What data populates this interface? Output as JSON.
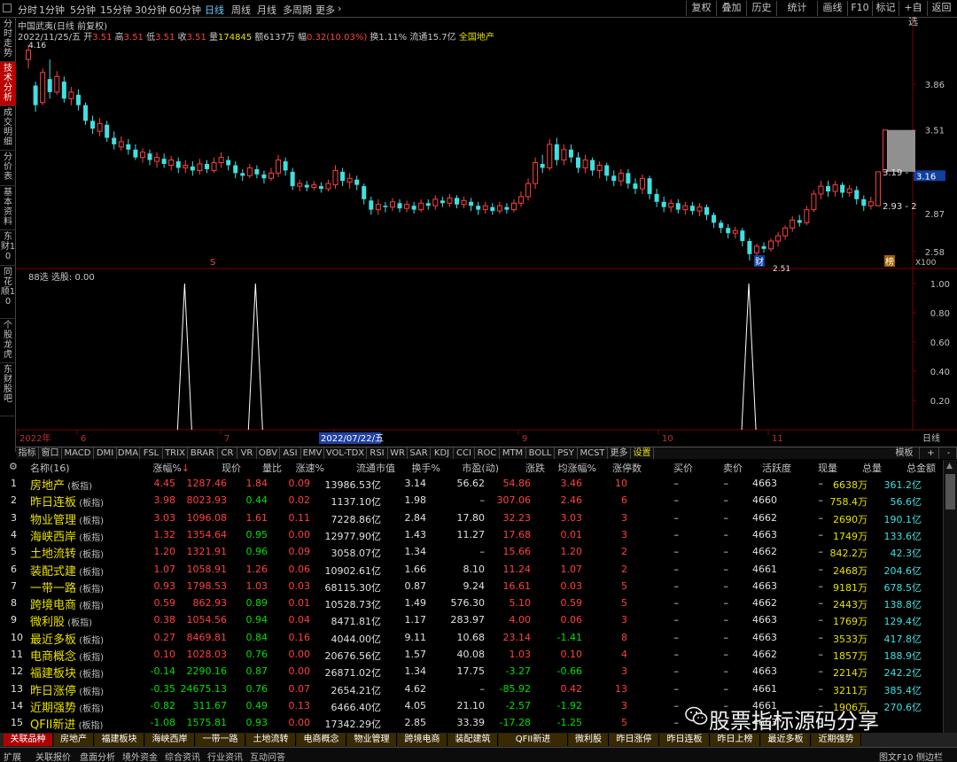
{
  "topbar": {
    "periods": [
      "分时",
      "1分钟",
      "5分钟",
      "15分钟",
      "30分钟",
      "60分钟",
      "日线",
      "周线",
      "月线",
      "多周期",
      "更多"
    ],
    "active_period": "日线",
    "right_buttons": [
      "复权",
      "叠加",
      "历史",
      "统计",
      "画线",
      "F10",
      "标记",
      "+自选",
      "返回"
    ]
  },
  "left_tabs": [
    "分时走势",
    "技术分析",
    "成交明细",
    "分价表",
    "基本资料",
    "东财10",
    "同花顺10",
    "个股龙虎",
    "东财股吧"
  ],
  "chart": {
    "title": "中国武夷(日线 前复权)",
    "date": "2022/11/25/五",
    "open_label": "开",
    "open": "3.51",
    "high_label": "高",
    "high": "3.51",
    "low_label": "低",
    "low": "3.51",
    "close_label": "收",
    "close": "3.51",
    "vol_label": "量",
    "vol": "174845",
    "amt_label": "额",
    "amt": "6137万",
    "chg_label": "幅",
    "chg": "0.32(10.03%)",
    "turnover": "换1.11%",
    "float": "流通15.7亿",
    "sector": "全国地产",
    "price_axis": [
      "3.86",
      "3.51",
      "3.16",
      "2.87",
      "2.58"
    ],
    "current_price_tag": "3.16",
    "label_high": "4.16",
    "label_low": "2.51",
    "label_b": "3.19 -",
    "label_c": "2.93 - 2",
    "marker_s": "S",
    "marker_cai": "财",
    "marker_x": "X100",
    "marker_bang": "榜",
    "sub_title": "88选",
    "sub_value_label": "选股: 0.00",
    "sub_axis": [
      "1.00",
      "0.80",
      "0.60",
      "0.40",
      "0.20"
    ],
    "x_labels": [
      "2022年",
      "6",
      "7",
      "8",
      "9",
      "10",
      "11"
    ],
    "x_highlight": "2022/07/22/五",
    "period_tag": "日线",
    "candles": [
      [
        4.05,
        4.12,
        3.98,
        4.16
      ],
      [
        3.85,
        3.7,
        3.65,
        3.88
      ],
      [
        3.72,
        3.95,
        3.7,
        3.98
      ],
      [
        3.9,
        3.8,
        3.75,
        4.05
      ],
      [
        3.8,
        3.92,
        3.78,
        3.96
      ],
      [
        3.88,
        3.75,
        3.72,
        3.92
      ],
      [
        3.75,
        3.8,
        3.7,
        3.84
      ],
      [
        3.78,
        3.7,
        3.66,
        3.82
      ],
      [
        3.7,
        3.58,
        3.55,
        3.72
      ],
      [
        3.58,
        3.52,
        3.48,
        3.62
      ],
      [
        3.5,
        3.56,
        3.46,
        3.6
      ],
      [
        3.55,
        3.45,
        3.42,
        3.58
      ],
      [
        3.45,
        3.4,
        3.36,
        3.5
      ],
      [
        3.38,
        3.42,
        3.35,
        3.46
      ],
      [
        3.4,
        3.36,
        3.32,
        3.44
      ],
      [
        3.36,
        3.3,
        3.28,
        3.4
      ],
      [
        3.3,
        3.34,
        3.26,
        3.37
      ],
      [
        3.33,
        3.28,
        3.24,
        3.36
      ],
      [
        3.27,
        3.3,
        3.22,
        3.34
      ],
      [
        3.29,
        3.25,
        3.22,
        3.33
      ],
      [
        3.24,
        3.28,
        3.2,
        3.31
      ],
      [
        3.27,
        3.22,
        3.18,
        3.3
      ],
      [
        3.22,
        3.24,
        3.18,
        3.28
      ],
      [
        3.23,
        3.2,
        3.16,
        3.27
      ],
      [
        3.2,
        3.25,
        3.17,
        3.29
      ],
      [
        3.25,
        3.21,
        3.18,
        3.28
      ],
      [
        3.2,
        3.26,
        3.18,
        3.3
      ],
      [
        3.26,
        3.3,
        3.22,
        3.34
      ],
      [
        3.28,
        3.24,
        3.2,
        3.31
      ],
      [
        3.24,
        3.18,
        3.14,
        3.27
      ],
      [
        3.18,
        3.16,
        3.12,
        3.21
      ],
      [
        3.16,
        3.22,
        3.14,
        3.25
      ],
      [
        3.21,
        3.17,
        3.14,
        3.24
      ],
      [
        3.17,
        3.14,
        3.1,
        3.2
      ],
      [
        3.14,
        3.18,
        3.12,
        3.22
      ],
      [
        3.18,
        3.28,
        3.15,
        3.32
      ],
      [
        3.27,
        3.2,
        3.16,
        3.3
      ],
      [
        3.19,
        3.08,
        3.05,
        3.22
      ],
      [
        3.08,
        3.1,
        3.04,
        3.13
      ],
      [
        3.09,
        3.07,
        3.04,
        3.12
      ],
      [
        3.07,
        3.09,
        3.05,
        3.12
      ],
      [
        3.08,
        3.06,
        3.03,
        3.11
      ],
      [
        3.06,
        3.1,
        3.04,
        3.13
      ],
      [
        3.09,
        3.2,
        3.06,
        3.24
      ],
      [
        3.19,
        3.12,
        3.08,
        3.22
      ],
      [
        3.11,
        3.14,
        3.06,
        3.18
      ],
      [
        3.13,
        3.09,
        3.05,
        3.16
      ],
      [
        3.08,
        2.98,
        2.94,
        3.1
      ],
      [
        2.97,
        2.9,
        2.86,
        3.0
      ],
      [
        2.9,
        2.94,
        2.86,
        2.98
      ],
      [
        2.93,
        2.92,
        2.88,
        2.96
      ],
      [
        2.92,
        2.96,
        2.89,
        2.99
      ],
      [
        2.95,
        2.91,
        2.88,
        2.98
      ],
      [
        2.91,
        2.94,
        2.88,
        2.97
      ],
      [
        2.93,
        2.9,
        2.87,
        2.96
      ],
      [
        2.9,
        2.95,
        2.88,
        2.98
      ],
      [
        2.95,
        2.93,
        2.9,
        2.98
      ],
      [
        2.93,
        2.98,
        2.9,
        3.01
      ],
      [
        2.97,
        2.95,
        2.92,
        3.0
      ],
      [
        2.95,
        2.99,
        2.92,
        3.02
      ],
      [
        2.99,
        2.94,
        2.91,
        3.01
      ],
      [
        2.94,
        2.97,
        2.91,
        3.0
      ],
      [
        2.96,
        2.93,
        2.89,
        2.99
      ],
      [
        2.93,
        2.9,
        2.86,
        2.96
      ],
      [
        2.9,
        2.93,
        2.87,
        2.96
      ],
      [
        2.92,
        2.89,
        2.86,
        2.95
      ],
      [
        2.89,
        2.93,
        2.87,
        2.96
      ],
      [
        2.92,
        2.9,
        2.87,
        2.95
      ],
      [
        2.9,
        2.95,
        2.88,
        2.98
      ],
      [
        2.95,
        3.0,
        2.92,
        3.04
      ],
      [
        3.0,
        3.1,
        2.97,
        3.14
      ],
      [
        3.1,
        3.26,
        3.06,
        3.3
      ],
      [
        3.25,
        3.22,
        3.18,
        3.32
      ],
      [
        3.22,
        3.4,
        3.2,
        3.44
      ],
      [
        3.4,
        3.28,
        3.24,
        3.45
      ],
      [
        3.28,
        3.36,
        3.24,
        3.4
      ],
      [
        3.36,
        3.3,
        3.26,
        3.4
      ],
      [
        3.3,
        3.22,
        3.18,
        3.34
      ],
      [
        3.22,
        3.28,
        3.18,
        3.32
      ],
      [
        3.28,
        3.2,
        3.16,
        3.3
      ],
      [
        3.2,
        3.24,
        3.14,
        3.27
      ],
      [
        3.24,
        3.16,
        3.12,
        3.26
      ],
      [
        3.16,
        3.12,
        3.08,
        3.2
      ],
      [
        3.12,
        3.18,
        3.08,
        3.21
      ],
      [
        3.18,
        3.1,
        3.06,
        3.21
      ],
      [
        3.1,
        3.06,
        3.02,
        3.14
      ],
      [
        3.06,
        3.14,
        3.02,
        3.17
      ],
      [
        3.14,
        3.02,
        2.98,
        3.16
      ],
      [
        3.02,
        2.96,
        2.92,
        3.06
      ],
      [
        2.96,
        2.92,
        2.88,
        3.0
      ],
      [
        2.92,
        2.95,
        2.88,
        2.98
      ],
      [
        2.95,
        2.9,
        2.87,
        2.98
      ],
      [
        2.9,
        2.93,
        2.86,
        2.96
      ],
      [
        2.93,
        2.89,
        2.86,
        2.96
      ],
      [
        2.89,
        2.92,
        2.85,
        2.95
      ],
      [
        2.92,
        2.86,
        2.82,
        2.94
      ],
      [
        2.86,
        2.8,
        2.76,
        2.88
      ],
      [
        2.8,
        2.76,
        2.72,
        2.82
      ],
      [
        2.76,
        2.72,
        2.68,
        2.79
      ],
      [
        2.72,
        2.74,
        2.68,
        2.77
      ],
      [
        2.74,
        2.66,
        2.62,
        2.76
      ],
      [
        2.66,
        2.56,
        2.51,
        2.68
      ],
      [
        2.57,
        2.62,
        2.55,
        2.64
      ],
      [
        2.62,
        2.6,
        2.57,
        2.65
      ],
      [
        2.6,
        2.66,
        2.58,
        2.68
      ],
      [
        2.66,
        2.7,
        2.62,
        2.73
      ],
      [
        2.7,
        2.76,
        2.67,
        2.78
      ],
      [
        2.76,
        2.82,
        2.73,
        2.85
      ],
      [
        2.82,
        2.8,
        2.77,
        2.86
      ],
      [
        2.8,
        2.9,
        2.78,
        2.93
      ],
      [
        2.9,
        3.02,
        2.88,
        3.05
      ],
      [
        3.02,
        3.08,
        2.98,
        3.12
      ],
      [
        3.08,
        3.04,
        3.0,
        3.12
      ],
      [
        3.04,
        3.09,
        3.0,
        3.12
      ],
      [
        3.09,
        3.03,
        2.99,
        3.11
      ],
      [
        3.03,
        3.06,
        3.0,
        3.09
      ],
      [
        3.05,
        2.98,
        2.94,
        3.08
      ],
      [
        2.98,
        2.93,
        2.89,
        3.01
      ],
      [
        2.93,
        2.96,
        2.9,
        3.0
      ],
      [
        2.93,
        3.19,
        2.93,
        3.19
      ],
      [
        3.19,
        3.51,
        3.19,
        3.51
      ]
    ],
    "signal_positions": [
      0.185,
      0.267,
      0.838
    ]
  },
  "indicators": [
    "指标",
    "窗口",
    "MACD",
    "DMI",
    "DMA",
    "FSL",
    "TRIX",
    "BRAR",
    "CR",
    "VR",
    "OBV",
    "ASI",
    "EMV",
    "VOL-TDX",
    "RSI",
    "WR",
    "SAR",
    "KDJ",
    "CCI",
    "ROC",
    "MTM",
    "BOLL",
    "PSY",
    "MCST",
    "更多",
    "设置"
  ],
  "ind_right": [
    "模板",
    "+",
    "-"
  ],
  "table": {
    "headers": [
      "名称(16)",
      "涨幅%",
      "现价",
      "量比",
      "涨速%",
      "流通市值",
      "换手%",
      "市盈(动)",
      "涨跌",
      "均涨幅%",
      "涨停数",
      "买价",
      "卖价",
      "活跃度",
      "现量",
      "总量",
      "总金额"
    ],
    "rows": [
      {
        "no": "1",
        "name": "房地产",
        "tag": "(板指)",
        "chg": "4.45",
        "price": "1287.46",
        "vr": "1.84",
        "spd": "0.09",
        "mcap": "13986.53亿",
        "turn": "3.14",
        "pe": "56.62",
        "diff": "54.86",
        "avg": "3.46",
        "limit": "10",
        "buy": "–",
        "sell": "–",
        "act": "4663",
        "cur": "–",
        "vol": "6638万",
        "amt": "361.2亿",
        "up": true
      },
      {
        "no": "2",
        "name": "昨日连板",
        "tag": "(板指)",
        "chg": "3.98",
        "price": "8023.93",
        "vr": "0.44",
        "spd": "0.02",
        "mcap": "1137.10亿",
        "turn": "1.98",
        "pe": "–",
        "diff": "307.06",
        "avg": "2.46",
        "limit": "6",
        "buy": "–",
        "sell": "–",
        "act": "4660",
        "cur": "–",
        "vol": "758.4万",
        "amt": "56.6亿",
        "up": true
      },
      {
        "no": "3",
        "name": "物业管理",
        "tag": "(板指)",
        "chg": "3.03",
        "price": "1096.08",
        "vr": "1.61",
        "spd": "0.11",
        "mcap": "7228.86亿",
        "turn": "2.84",
        "pe": "17.80",
        "diff": "32.23",
        "avg": "3.03",
        "limit": "3",
        "buy": "–",
        "sell": "–",
        "act": "4662",
        "cur": "–",
        "vol": "2690万",
        "amt": "190.1亿",
        "up": true
      },
      {
        "no": "4",
        "name": "海峡西岸",
        "tag": "(板指)",
        "chg": "1.32",
        "price": "1354.64",
        "vr": "0.95",
        "spd": "0.00",
        "mcap": "12977.90亿",
        "turn": "1.43",
        "pe": "11.27",
        "diff": "17.68",
        "avg": "0.01",
        "limit": "3",
        "buy": "–",
        "sell": "–",
        "act": "4663",
        "cur": "–",
        "vol": "1749万",
        "amt": "133.6亿",
        "up": true
      },
      {
        "no": "5",
        "name": "土地流转",
        "tag": "(板指)",
        "chg": "1.20",
        "price": "1321.91",
        "vr": "0.96",
        "spd": "0.09",
        "mcap": "3058.07亿",
        "turn": "1.34",
        "pe": "–",
        "diff": "15.66",
        "avg": "1.20",
        "limit": "2",
        "buy": "–",
        "sell": "–",
        "act": "4662",
        "cur": "–",
        "vol": "842.2万",
        "amt": "42.3亿",
        "up": true
      },
      {
        "no": "6",
        "name": "装配式建",
        "tag": "(板指)",
        "chg": "1.07",
        "price": "1058.91",
        "vr": "1.26",
        "spd": "0.06",
        "mcap": "10902.61亿",
        "turn": "1.66",
        "pe": "8.10",
        "diff": "11.24",
        "avg": "1.07",
        "limit": "2",
        "buy": "–",
        "sell": "–",
        "act": "4661",
        "cur": "–",
        "vol": "2468万",
        "amt": "204.6亿",
        "up": true
      },
      {
        "no": "7",
        "name": "一带一路",
        "tag": "(板指)",
        "chg": "0.93",
        "price": "1798.53",
        "vr": "1.03",
        "spd": "0.03",
        "mcap": "68115.30亿",
        "turn": "0.87",
        "pe": "9.24",
        "diff": "16.61",
        "avg": "0.03",
        "limit": "5",
        "buy": "–",
        "sell": "–",
        "act": "4663",
        "cur": "–",
        "vol": "9181万",
        "amt": "678.5亿",
        "up": true
      },
      {
        "no": "8",
        "name": "跨境电商",
        "tag": "(板指)",
        "chg": "0.59",
        "price": "862.93",
        "vr": "0.89",
        "spd": "0.01",
        "mcap": "10528.73亿",
        "turn": "1.49",
        "pe": "576.30",
        "diff": "5.10",
        "avg": "0.59",
        "limit": "5",
        "buy": "–",
        "sell": "–",
        "act": "4662",
        "cur": "–",
        "vol": "2443万",
        "amt": "138.8亿",
        "up": true
      },
      {
        "no": "9",
        "name": "微利股",
        "tag": "(板指)",
        "chg": "0.38",
        "price": "1054.56",
        "vr": "0.94",
        "spd": "0.04",
        "mcap": "8471.81亿",
        "turn": "1.17",
        "pe": "283.97",
        "diff": "4.00",
        "avg": "0.06",
        "limit": "3",
        "buy": "–",
        "sell": "–",
        "act": "4663",
        "cur": "–",
        "vol": "1769万",
        "amt": "129.4亿",
        "up": true
      },
      {
        "no": "10",
        "name": "最近多板",
        "tag": "(板指)",
        "chg": "0.27",
        "price": "8469.81",
        "vr": "0.84",
        "spd": "0.16",
        "mcap": "4044.00亿",
        "turn": "9.11",
        "pe": "10.68",
        "diff": "23.14",
        "avg": "-1.41",
        "limit": "8",
        "buy": "–",
        "sell": "–",
        "act": "4663",
        "cur": "–",
        "vol": "3533万",
        "amt": "417.8亿",
        "up": true
      },
      {
        "no": "11",
        "name": "电商概念",
        "tag": "(板指)",
        "chg": "0.10",
        "price": "1028.03",
        "vr": "0.76",
        "spd": "0.00",
        "mcap": "20676.56亿",
        "turn": "1.57",
        "pe": "40.08",
        "diff": "1.03",
        "avg": "0.10",
        "limit": "4",
        "buy": "–",
        "sell": "–",
        "act": "4662",
        "cur": "–",
        "vol": "1857万",
        "amt": "188.9亿",
        "up": true
      },
      {
        "no": "12",
        "name": "福建板块",
        "tag": "(板指)",
        "chg": "-0.14",
        "price": "2290.16",
        "vr": "0.87",
        "spd": "0.00",
        "mcap": "26871.02亿",
        "turn": "1.34",
        "pe": "17.75",
        "diff": "-3.27",
        "avg": "-0.66",
        "limit": "3",
        "buy": "–",
        "sell": "–",
        "act": "4663",
        "cur": "–",
        "vol": "2214万",
        "amt": "242.2亿",
        "up": false
      },
      {
        "no": "13",
        "name": "昨日涨停",
        "tag": "(板指)",
        "chg": "-0.35",
        "price": "24675.13",
        "vr": "0.76",
        "spd": "0.07",
        "mcap": "2654.21亿",
        "turn": "4.62",
        "pe": "–",
        "diff": "-85.92",
        "avg": "0.42",
        "limit": "13",
        "buy": "–",
        "sell": "–",
        "act": "4661",
        "cur": "–",
        "vol": "3211万",
        "amt": "385.4亿",
        "up": false
      },
      {
        "no": "14",
        "name": "近期强势",
        "tag": "(板指)",
        "chg": "-0.82",
        "price": "311.67",
        "vr": "0.49",
        "spd": "0.13",
        "mcap": "6466.40亿",
        "turn": "4.05",
        "pe": "21.10",
        "diff": "-2.57",
        "avg": "-1.92",
        "limit": "3",
        "buy": "–",
        "sell": "–",
        "act": "4661",
        "cur": "–",
        "vol": "1906万",
        "amt": "270.6亿",
        "up": false
      },
      {
        "no": "15",
        "name": "QFII新进",
        "tag": "(板指)",
        "chg": "-1.08",
        "price": "1575.81",
        "vr": "0.93",
        "spd": "0.00",
        "mcap": "17342.29亿",
        "turn": "2.85",
        "pe": "33.39",
        "diff": "-17.28",
        "avg": "-1.25",
        "limit": "5",
        "buy": "–",
        "sell": "–",
        "act": "4663",
        "cur": "–",
        "vol": "",
        "amt": "",
        "up": false
      }
    ]
  },
  "sheet_tabs": [
    "关联品种",
    "房地产",
    "福建板块",
    "海峡西岸",
    "一带一路",
    "土地流转",
    "电商概念",
    "物业管理",
    "跨境电商",
    "装配建筑",
    "QFII新进",
    "微利股",
    "昨日涨停",
    "昨日连板",
    "昨日上榜",
    "最近多板",
    "近期强势"
  ],
  "status_items": [
    "扩展",
    "关联报价",
    "盘面分析",
    "境外资金",
    "综合资讯",
    "行业资讯",
    "互动问答"
  ],
  "status_right": [
    "图文F10",
    "侧边栏"
  ],
  "watermark": "股票指标源码分享",
  "colors": {
    "up": "#ff4040",
    "down": "#40e0e0",
    "bg": "#000000",
    "accent": "#b00000"
  }
}
